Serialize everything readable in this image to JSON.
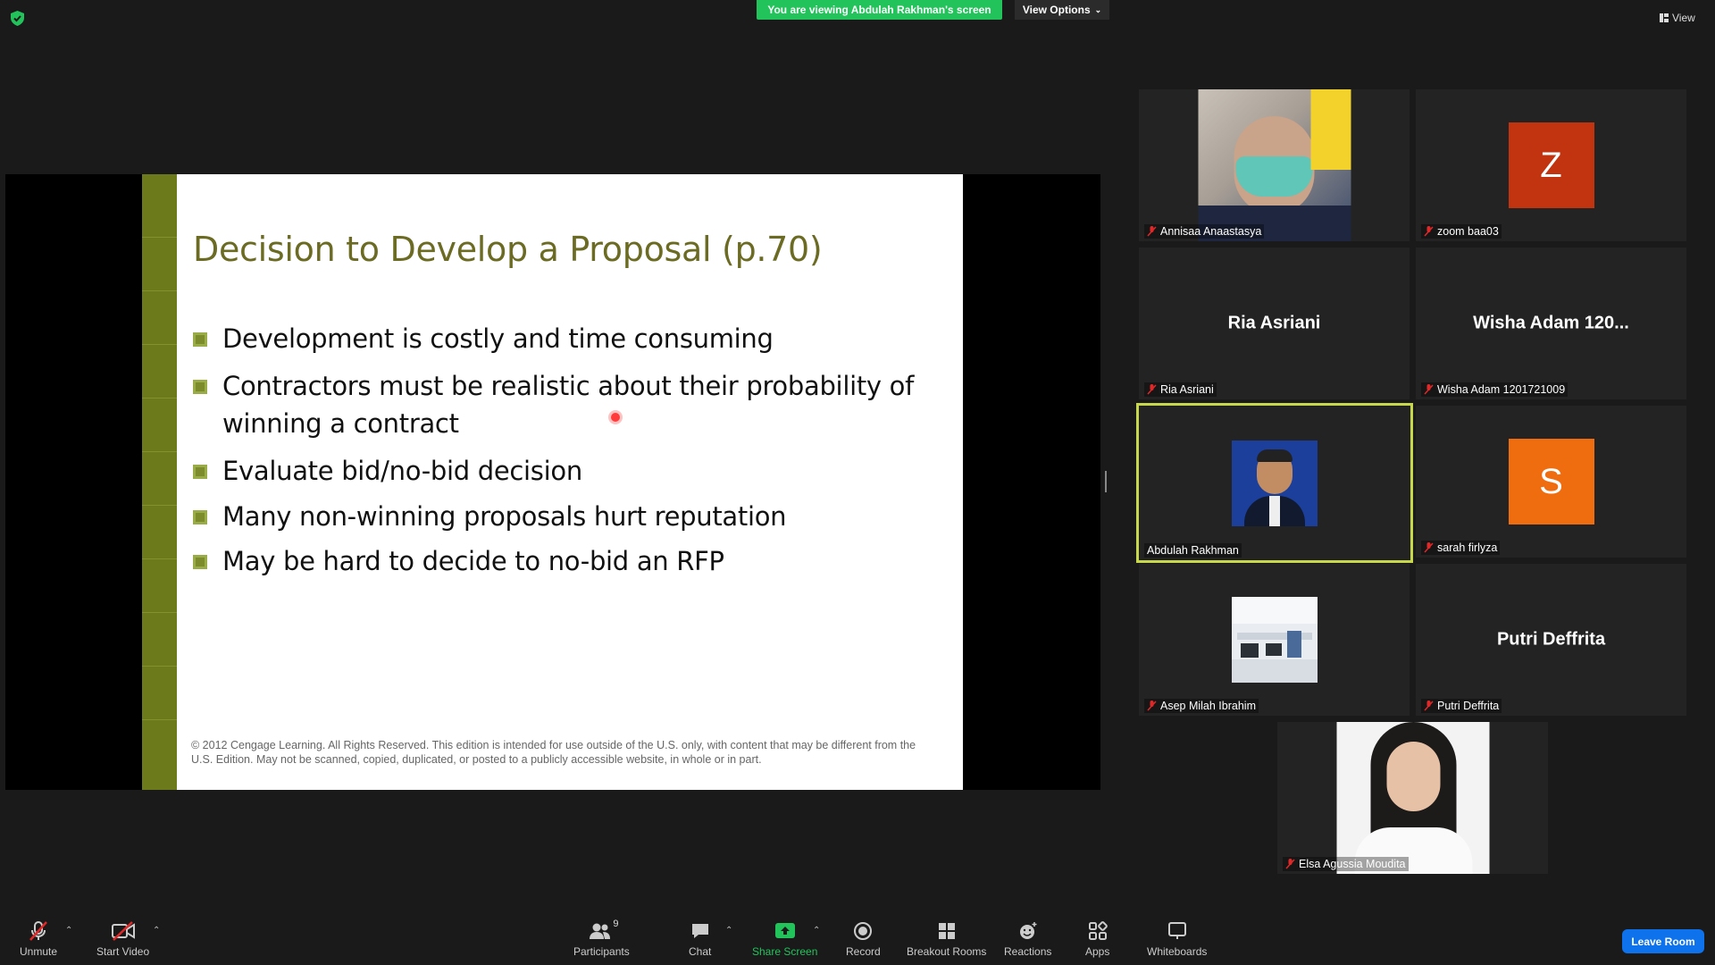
{
  "topbar": {
    "viewing_banner": "You are viewing Abdulah Rakhman's screen",
    "view_options_label": "View Options",
    "view_label": "View"
  },
  "slide": {
    "title": "Decision to Develop a Proposal (p.70)",
    "bullets": [
      "Development is costly and time consuming",
      "Contractors must be realistic about their probability of winning a contract",
      "Evaluate bid/no-bid decision",
      "Many non-winning proposals hurt reputation",
      "May be hard to decide to no-bid an RFP"
    ],
    "footer": "© 2012 Cengage Learning. All Rights Reserved. This edition is intended for use outside of the U.S. only, with content that may be different from the U.S. Edition. May not be scanned, copied, duplicated, or posted to a publicly accessible website, in whole or in part."
  },
  "participants": [
    {
      "label": "Annisaa Anaastasya",
      "muted": true
    },
    {
      "label": "zoom baa03",
      "muted": true,
      "avatar_letter": "Z",
      "avatar_color": "#c1340f"
    },
    {
      "label": "Ria Asriani",
      "display_name": "Ria Asriani",
      "muted": true
    },
    {
      "label": "Wisha Adam 1201721009",
      "display_name": "Wisha Adam 120...",
      "muted": true
    },
    {
      "label": "Abdulah Rakhman",
      "muted": false,
      "active_speaker": true,
      "highlight_color": "#c7d94a"
    },
    {
      "label": "sarah firlyza",
      "muted": true,
      "avatar_letter": "S",
      "avatar_color": "#ef6c0f"
    },
    {
      "label": "Asep Milah Ibrahim",
      "muted": true
    },
    {
      "label": "Putri Deffrita",
      "display_name": "Putri Deffrita",
      "muted": true
    },
    {
      "label": "Elsa Agussia Moudita",
      "muted": true
    }
  ],
  "toolbar": {
    "unmute": "Unmute",
    "start_video": "Start Video",
    "participants": "Participants",
    "participants_count": "9",
    "chat": "Chat",
    "share_screen": "Share Screen",
    "record": "Record",
    "breakout_rooms": "Breakout Rooms",
    "reactions": "Reactions",
    "apps": "Apps",
    "whiteboards": "Whiteboards",
    "leave_room": "Leave Room"
  },
  "colors": {
    "share_green": "#23c35b",
    "leave_blue": "#0e72ed",
    "muted_red": "#e02828"
  }
}
